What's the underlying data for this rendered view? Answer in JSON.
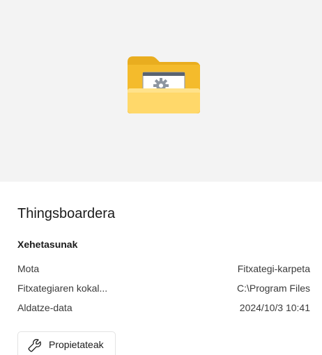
{
  "preview": {
    "icon": "folder-with-gear-icon"
  },
  "item": {
    "name": "Thingsboardera"
  },
  "details": {
    "title": "Xehetasunak",
    "rows": [
      {
        "label": "Mota",
        "value": "Fitxategi-karpeta"
      },
      {
        "label": "Fitxategiaren kokal...",
        "value": "C:\\Program Files"
      },
      {
        "label": "Aldatze-data",
        "value": "2024/10/3 10:41"
      }
    ]
  },
  "actions": {
    "properties_label": "Propietateak",
    "properties_icon": "wrench-icon"
  },
  "colors": {
    "preview_bg": "#f3f3f3",
    "folder_yellow": "#f9c945",
    "folder_front": "#ffd86a"
  }
}
